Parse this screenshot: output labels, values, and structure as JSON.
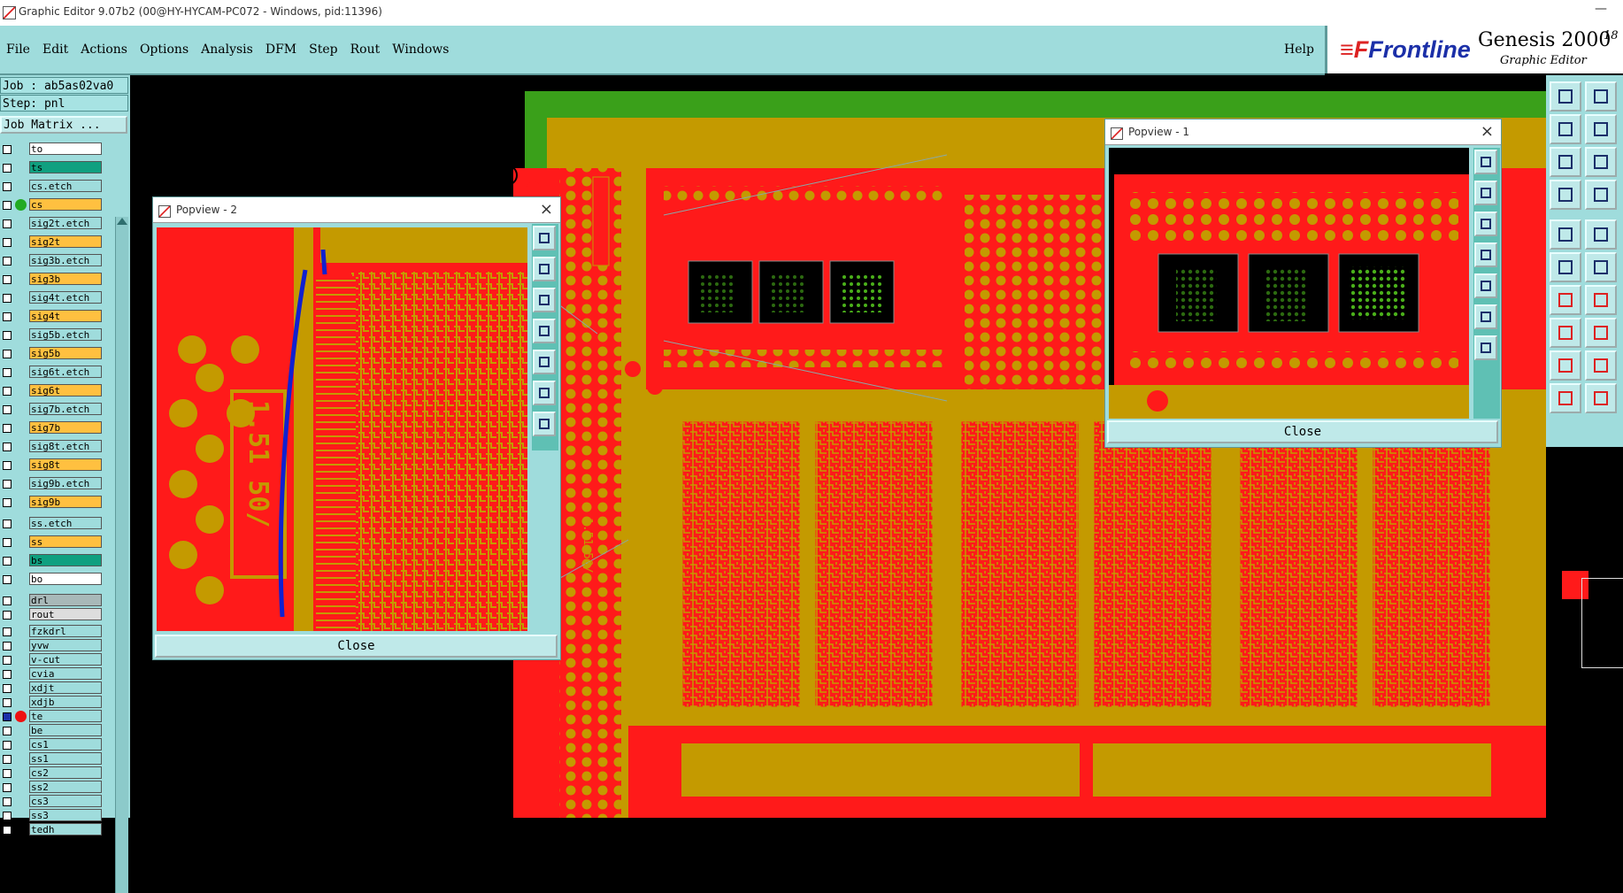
{
  "window": {
    "title": "Graphic Editor 9.07b2 (00@HY-HYCAM-PC072 - Windows, pid:11396)",
    "minimize_glyph": "—"
  },
  "menu": {
    "items": [
      "File",
      "Edit",
      "Actions",
      "Options",
      "Analysis",
      "DFM",
      "Step",
      "Rout",
      "Windows"
    ],
    "help": "Help"
  },
  "brand": {
    "logo": "Frontline",
    "logo_mark": "≡F",
    "product": "Genesis 2000",
    "subtitle": "Graphic Editor",
    "corner": "18"
  },
  "job": {
    "job_line": "Job : ab5as02va0",
    "step_line": "Step: pnl",
    "matrix_button": "Job Matrix ..."
  },
  "layers": [
    {
      "name": "to",
      "color": "#ffffff"
    },
    {
      "name": "ts",
      "color": "#10a080"
    },
    {
      "name": "cs.etch",
      "color": "#9fdcdc"
    },
    {
      "name": "cs",
      "color": "#ffc040",
      "dot": "#22aa22"
    },
    {
      "name": "sig2t.etch",
      "color": "#9fdcdc"
    },
    {
      "name": "sig2t",
      "color": "#ffc040"
    },
    {
      "name": "sig3b.etch",
      "color": "#9fdcdc"
    },
    {
      "name": "sig3b",
      "color": "#ffc040"
    },
    {
      "name": "sig4t.etch",
      "color": "#9fdcdc"
    },
    {
      "name": "sig4t",
      "color": "#ffc040"
    },
    {
      "name": "sig5b.etch",
      "color": "#9fdcdc"
    },
    {
      "name": "sig5b",
      "color": "#ffc040"
    },
    {
      "name": "sig6t.etch",
      "color": "#9fdcdc"
    },
    {
      "name": "sig6t",
      "color": "#ffc040"
    },
    {
      "name": "sig7b.etch",
      "color": "#9fdcdc"
    },
    {
      "name": "sig7b",
      "color": "#ffc040"
    },
    {
      "name": "sig8t.etch",
      "color": "#9fdcdc"
    },
    {
      "name": "sig8t",
      "color": "#ffc040"
    },
    {
      "name": "sig9b.etch",
      "color": "#9fdcdc"
    },
    {
      "name": "sig9b",
      "color": "#ffc040"
    },
    {
      "name": "ss.etch",
      "color": "#9fdcdc"
    },
    {
      "name": "ss",
      "color": "#ffc040"
    },
    {
      "name": "bs",
      "color": "#10a080"
    },
    {
      "name": "bo",
      "color": "#ffffff"
    },
    {
      "name": "drl",
      "color": "#a8b8b8"
    },
    {
      "name": "rout",
      "color": "#dddddd"
    },
    {
      "name": "fzkdrl",
      "color": "#9fdcdc"
    },
    {
      "name": "yvw",
      "color": "#9fdcdc"
    },
    {
      "name": "v-cut",
      "color": "#9fdcdc"
    },
    {
      "name": "cvia",
      "color": "#9fdcdc"
    },
    {
      "name": "xdjt",
      "color": "#9fdcdc"
    },
    {
      "name": "xdjb",
      "color": "#9fdcdc"
    },
    {
      "name": "te",
      "color": "#9fdcdc",
      "dot": "#ee1111",
      "active": true
    },
    {
      "name": "be",
      "color": "#9fdcdc"
    },
    {
      "name": "cs1",
      "color": "#9fdcdc"
    },
    {
      "name": "ss1",
      "color": "#9fdcdc"
    },
    {
      "name": "cs2",
      "color": "#9fdcdc"
    },
    {
      "name": "ss2",
      "color": "#9fdcdc"
    },
    {
      "name": "cs3",
      "color": "#9fdcdc"
    },
    {
      "name": "ss3",
      "color": "#9fdcdc"
    },
    {
      "name": "tedh",
      "color": "#9fdcdc"
    }
  ],
  "popview2": {
    "title": "Popview - 2",
    "close_label": "Close",
    "silk_text": "1.51 50/"
  },
  "popview1": {
    "title": "Popview - 1",
    "close_label": "Close"
  },
  "main_silk_text": "1.51 50/",
  "colors": {
    "board_red": "#ff1a1a",
    "copper": "#c49a00",
    "panel_green": "#3aa01a",
    "ui_teal": "#9fdcdc"
  }
}
